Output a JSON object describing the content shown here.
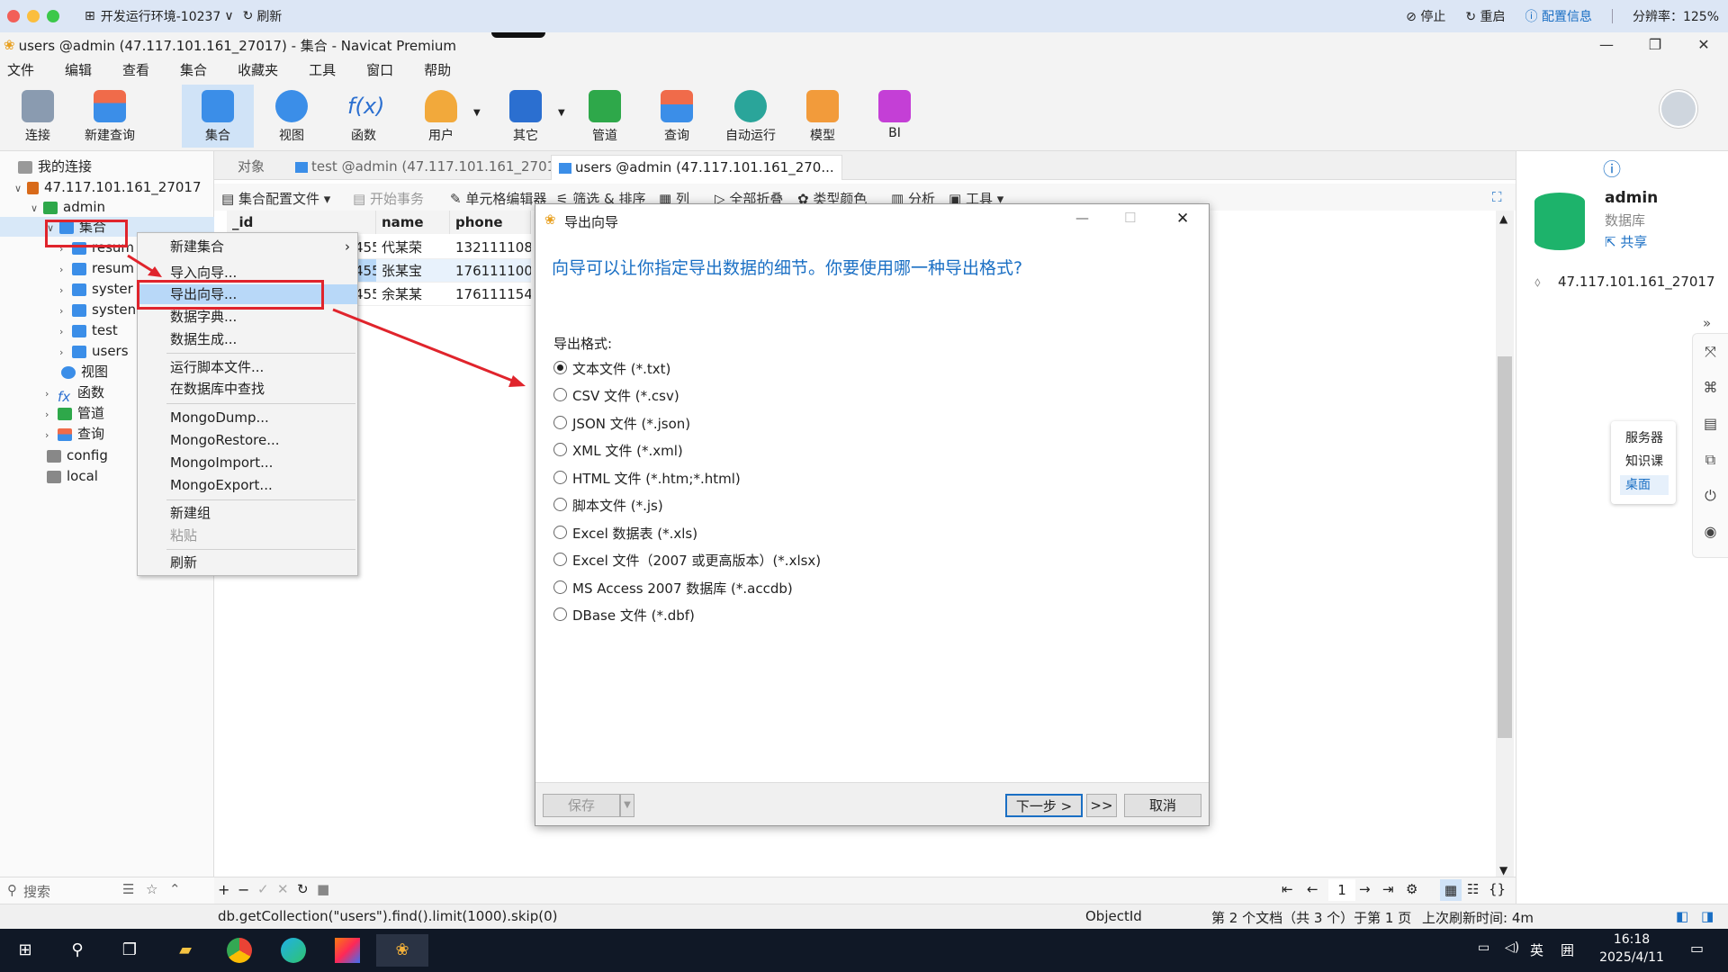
{
  "outer_bar": {
    "env_title": "开发运行环境-10237",
    "refresh": "刷新",
    "stop": "停止",
    "restart": "重启",
    "config": "配置信息",
    "resolution": "分辨率：125%"
  },
  "window": {
    "title": "users @admin (47.117.101.161_27017) - 集合 - Navicat Premium"
  },
  "menu": [
    "文件",
    "编辑",
    "查看",
    "集合",
    "收藏夹",
    "工具",
    "窗口",
    "帮助"
  ],
  "toolbar": {
    "buttons": [
      "连接",
      "新建查询",
      "集合",
      "视图",
      "函数",
      "用户",
      "其它",
      "管道",
      "查询",
      "自动运行",
      "模型",
      "BI"
    ]
  },
  "tree": {
    "root": "我的连接",
    "connection": "47.117.101.161_27017",
    "db": "admin",
    "collections_group": "集合",
    "collections": [
      "resum",
      "resum",
      "syster",
      "systen",
      "test",
      "users"
    ],
    "views": "视图",
    "functions": "函数",
    "pipelines": "管道",
    "queries": "查询",
    "other_dbs": [
      "config",
      "local"
    ]
  },
  "search": {
    "placeholder": "搜索"
  },
  "tabs": {
    "objects": "对象",
    "tab1": "test @admin (47.117.101.161_2701...",
    "tab2": "users @admin (47.117.101.161_270..."
  },
  "grid_toolbar": {
    "config": "集合配置文件",
    "begin_tx": "开始事务",
    "cell_editor": "单元格编辑器",
    "filter_sort": "筛选 & 排序",
    "columns": "列",
    "collapse_all": "全部折叠",
    "type_color": "类型颜色",
    "analyze": "分析",
    "tools": "工具"
  },
  "grid": {
    "headers": [
      "_id",
      "name",
      "phone"
    ],
    "rows": [
      [
        "455",
        "代某荣",
        "132111108"
      ],
      [
        "455",
        "张某宝",
        "176111100"
      ],
      [
        "455",
        "余某某",
        "176111154"
      ]
    ]
  },
  "context_menu": {
    "items": [
      "新建集合",
      "导入向导...",
      "导出向导...",
      "数据字典...",
      "数据生成...",
      "运行脚本文件...",
      "在数据库中查找",
      "MongoDump...",
      "MongoRestore...",
      "MongoImport...",
      "MongoExport...",
      "新建组",
      "粘贴",
      "刷新"
    ]
  },
  "dialog": {
    "title": "导出向导",
    "question": "向导可以让你指定导出数据的细节。你要使用哪一种导出格式?",
    "format_label": "导出格式:",
    "formats": [
      "文本文件 (*.txt)",
      "CSV 文件 (*.csv)",
      "JSON 文件 (*.json)",
      "XML 文件 (*.xml)",
      "HTML 文件 (*.htm;*.html)",
      "脚本文件 (*.js)",
      "Excel 数据表 (*.xls)",
      "Excel 文件（2007 或更高版本）(*.xlsx)",
      "MS Access 2007 数据库 (*.accdb)",
      "DBase 文件 (*.dbf)"
    ],
    "selected_index": 0,
    "save": "保存",
    "next": "下一步 >",
    "finish": ">>",
    "cancel": "取消"
  },
  "pager": {
    "page": "1"
  },
  "statusbar": {
    "query": "db.getCollection(\"users\").find().limit(1000).skip(0)",
    "type": "ObjectId",
    "doc_info": "第 2 个文档（共 3 个）于第 1 页",
    "last_refresh": "上次刷新时间: 4m"
  },
  "right_panel": {
    "db_name": "admin",
    "db_type": "数据库",
    "share": "共享",
    "host": "47.117.101.161_27017",
    "popup": [
      "服务器",
      "知识课",
      "桌面"
    ]
  },
  "taskbar": {
    "time": "16:18",
    "date": "2025/4/11",
    "ime": "英",
    "ime2": "囲"
  },
  "colors": {
    "accent": "#1a6fc4",
    "annotation_red": "#e0242c",
    "db_green": "#1db36b"
  }
}
